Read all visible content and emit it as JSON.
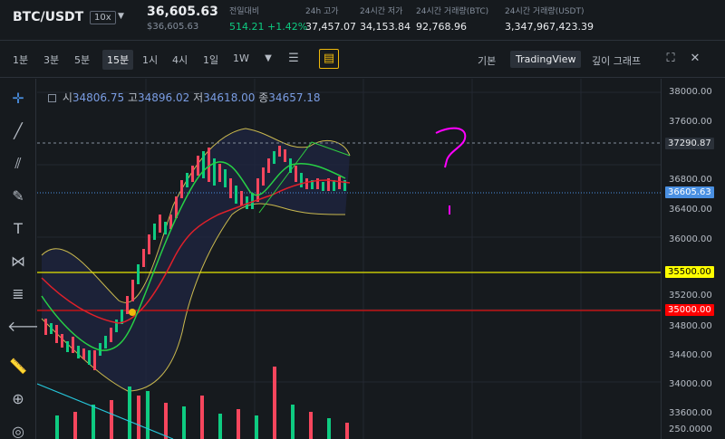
{
  "header": {
    "pair": "BTC/USDT",
    "leverage": "10x",
    "last_price": "36,605.63",
    "last_price_usd": "$36,605.63",
    "stats": [
      {
        "label": "전일대비",
        "value": "514.21 +1.42%",
        "color": "#0ecb81"
      },
      {
        "label": "24h 고가",
        "value": "37,457.07"
      },
      {
        "label": "24시간 저가",
        "value": "34,153.84"
      },
      {
        "label": "24시간 거래량(BTC)",
        "value": "92,768.96"
      },
      {
        "label": "24시간 거래량(USDT)",
        "value": "3,347,967,423.39"
      }
    ]
  },
  "toolbar": {
    "timeframes": [
      "1분",
      "3분",
      "5분",
      "15분",
      "1시",
      "4시",
      "1일",
      "1W"
    ],
    "active_timeframe": "15분",
    "views": [
      "기본",
      "TradingView",
      "깊이 그래프"
    ],
    "active_view": "TradingView"
  },
  "ohlc": {
    "open_label": "시",
    "open": "34806.75",
    "high_label": "고",
    "high": "34896.02",
    "low_label": "저",
    "low": "34618.00",
    "close_label": "종",
    "close": "34657.18"
  },
  "axis": {
    "ticks": [
      "38000.00",
      "37600.00",
      "36800.00",
      "36400.00",
      "36000.00",
      "35200.00",
      "34800.00",
      "34400.00",
      "34000.00",
      "33600.00",
      "250.0000"
    ],
    "labels": [
      {
        "text": "37290.87",
        "bg": "#2b3139",
        "fg": "#eaecef"
      },
      {
        "text": "36605.63",
        "bg": "#4a90e2",
        "fg": "#ffffff"
      },
      {
        "text": "35500.00",
        "bg": "#ffff00",
        "fg": "#000000"
      },
      {
        "text": "35000.00",
        "bg": "#ff0000",
        "fg": "#ffffff"
      }
    ]
  },
  "colors": {
    "up": "#0ecb81",
    "down": "#f6465d",
    "accent": "#f0b90b",
    "annotation": "#ff00ff"
  },
  "annotation": {
    "text": "?"
  }
}
